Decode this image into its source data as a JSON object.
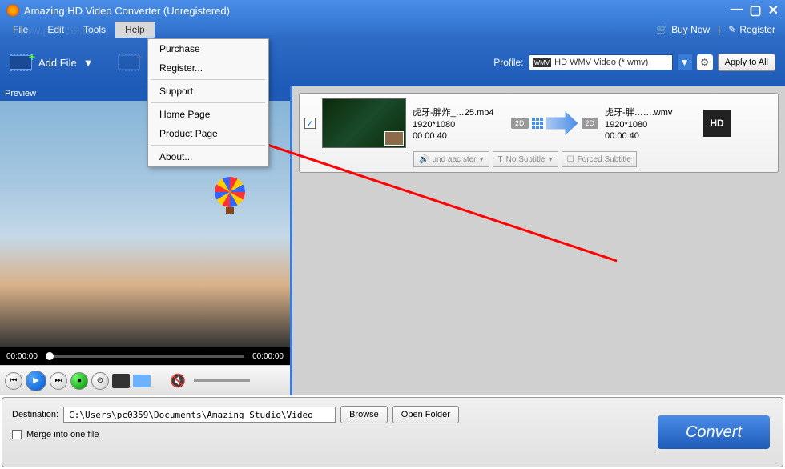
{
  "title": "Amazing HD Video Converter (Unregistered)",
  "watermark": "www.pc0359.cn",
  "menubar": {
    "items": [
      "File",
      "Edit",
      "Tools",
      "Help"
    ],
    "buy_now": "Buy Now",
    "register": "Register"
  },
  "toolbar": {
    "add_file": "Add File",
    "edit": "Edit",
    "profile_label": "Profile:",
    "profile_value": "HD WMV Video (*.wmv)",
    "apply_all": "Apply to All"
  },
  "dropdown": {
    "purchase": "Purchase",
    "register": "Register...",
    "support": "Support",
    "home": "Home Page",
    "product": "Product Page",
    "about": "About..."
  },
  "preview": {
    "header": "Preview",
    "time_start": "00:00:00",
    "time_end": "00:00:00"
  },
  "file": {
    "src_name": "虎牙-胖炸_…25.mp4",
    "src_res": "1920*1080",
    "src_dur": "00:00:40",
    "dst_name": "虎牙-胖…….wmv",
    "dst_res": "1920*1080",
    "dst_dur": "00:00:40",
    "badge_2d_left": "2D",
    "badge_2d_right": "2D",
    "hd": "HD",
    "audio": "und aac ster",
    "no_sub": "No Subtitle",
    "forced_sub": "Forced Subtitle"
  },
  "bottom": {
    "dest_label": "Destination:",
    "dest_path": "C:\\Users\\pc0359\\Documents\\Amazing Studio\\Video",
    "browse": "Browse",
    "open_folder": "Open Folder",
    "merge": "Merge into one file",
    "convert": "Convert"
  }
}
